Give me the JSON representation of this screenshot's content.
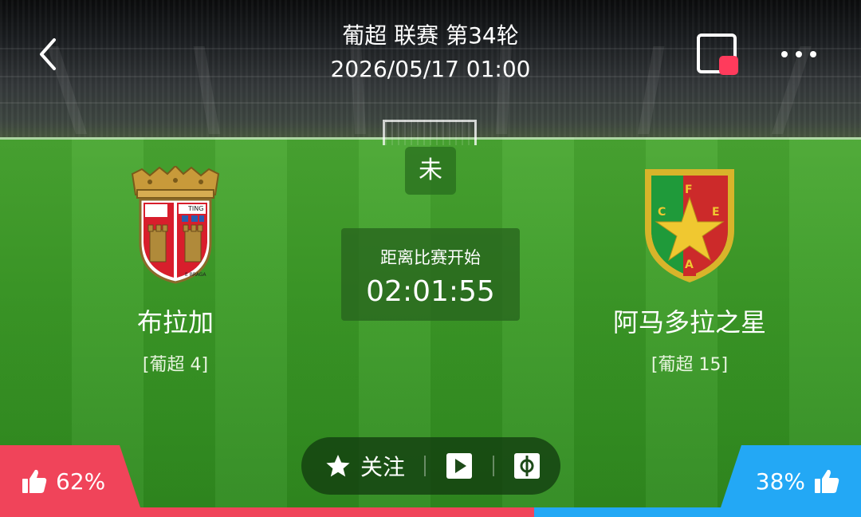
{
  "header": {
    "title": "葡超 联赛 第34轮",
    "datetime": "2026/05/17 01:00"
  },
  "match": {
    "status": "未",
    "countdown_label": "距离比赛开始",
    "countdown_time": "02:01:55"
  },
  "home_team": {
    "name": "布拉加",
    "rank": "[葡超 4]"
  },
  "away_team": {
    "name": "阿马多拉之星",
    "rank": "[葡超 15]"
  },
  "actions": {
    "follow_label": "关注"
  },
  "vote": {
    "home_pct_text": "62%",
    "away_pct_text": "38%",
    "home_fraction": 0.62,
    "away_fraction": 0.38
  },
  "colors": {
    "record_dot": "#ff3b5c",
    "vote_home": "#f0445a",
    "vote_away": "#23a8f5",
    "pitch": "#3d9c28"
  },
  "icons": {
    "back": "chevron-left-icon",
    "record": "screen-record-icon",
    "more": "more-dots-icon",
    "follow": "star-icon",
    "play": "play-icon",
    "pitch_view": "pitch-icon",
    "thumbs_up": "thumbs-up-icon"
  }
}
